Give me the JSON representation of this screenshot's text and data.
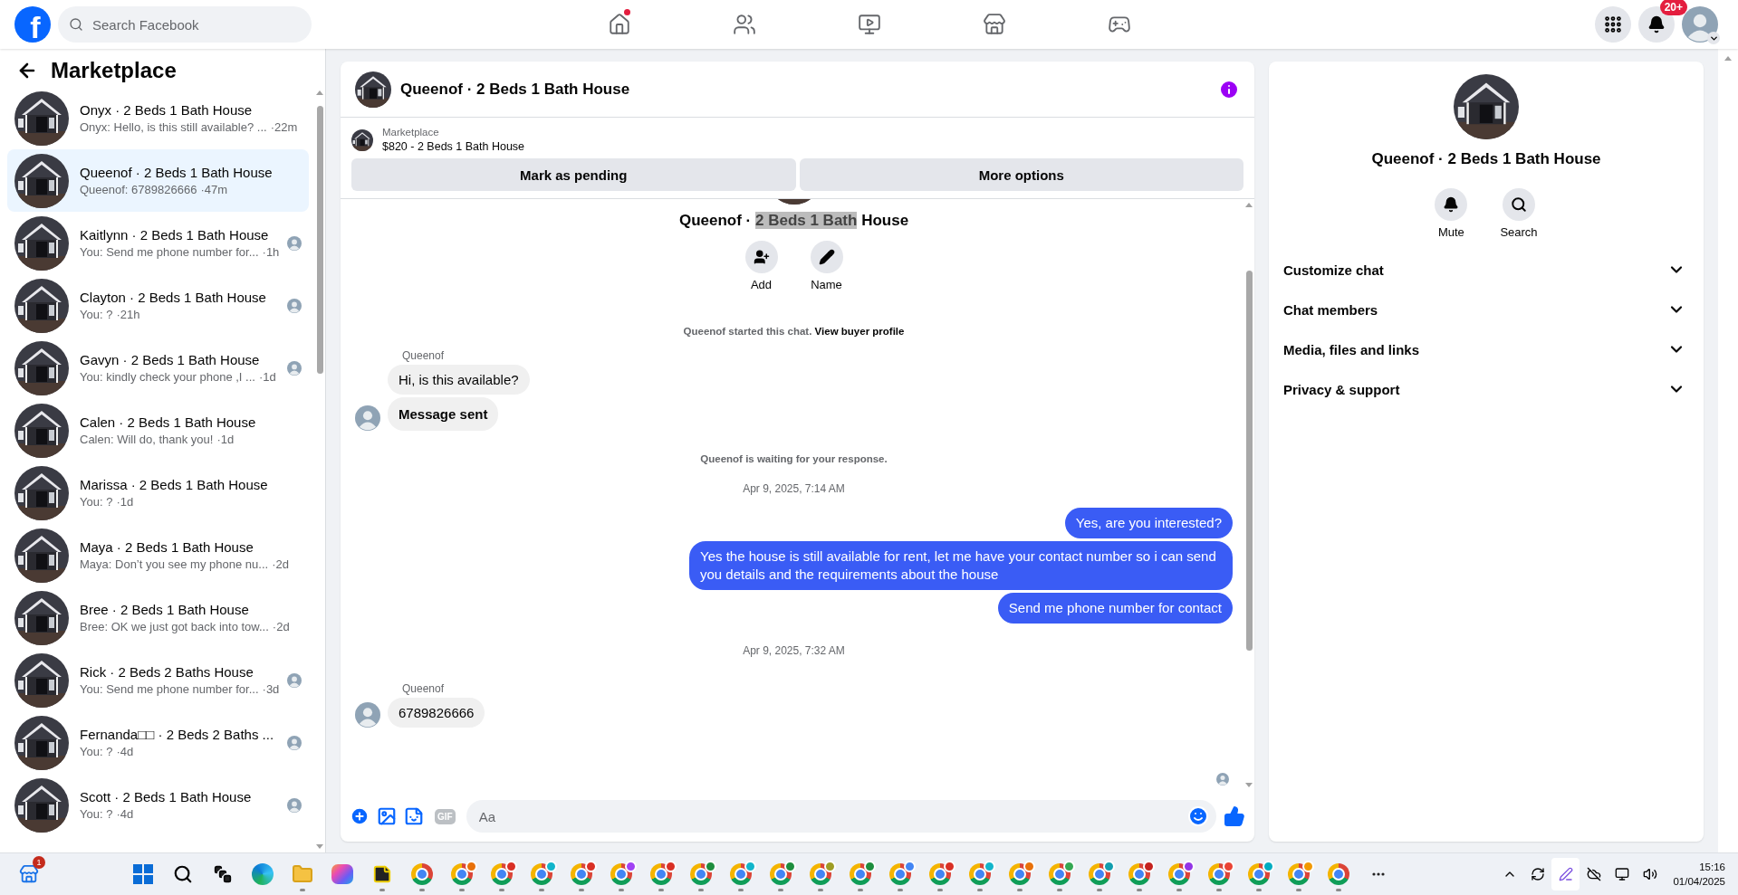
{
  "topbar": {
    "logo": "f",
    "search": {
      "placeholder": "Search Facebook"
    },
    "nav": [
      {
        "kind": "home",
        "dot": true
      },
      {
        "kind": "friends",
        "dot": false
      },
      {
        "kind": "video",
        "dot": false
      },
      {
        "kind": "marketplace",
        "dot": false
      },
      {
        "kind": "gaming",
        "dot": false
      }
    ],
    "notifications_badge": "20+"
  },
  "sidebar": {
    "title": "Marketplace",
    "conversations": [
      {
        "title": "Onyx · 2 Beds 1 Bath House",
        "preview": "Onyx: Hello, is this still available? ...",
        "time": "·22m",
        "seen": false,
        "selected": false
      },
      {
        "title": "Queenof · 2 Beds 1 Bath House",
        "preview": "Queenof: 6789826666",
        "time": "·47m",
        "seen": false,
        "selected": true
      },
      {
        "title": "Kaitlynn · 2 Beds 1 Bath House",
        "preview": "You: Send me phone number for...",
        "time": "·1h",
        "seen": true,
        "selected": false
      },
      {
        "title": "Clayton · 2 Beds 1 Bath House",
        "preview": "You: ?",
        "time": "·21h",
        "seen": true,
        "selected": false
      },
      {
        "title": "Gavyn · 2 Beds 1 Bath House",
        "preview": "You: kindly check your phone ,I ...",
        "time": "·1d",
        "seen": true,
        "selected": false
      },
      {
        "title": "Calen · 2 Beds 1 Bath House",
        "preview": "Calen: Will do, thank you!",
        "time": "·1d",
        "seen": false,
        "selected": false
      },
      {
        "title": "Marissa · 2 Beds 1 Bath House",
        "preview": "You: ?",
        "time": "·1d",
        "seen": false,
        "selected": false
      },
      {
        "title": "Maya · 2 Beds 1 Bath House",
        "preview": "Maya: Don’t you see my phone nu...",
        "time": "·2d",
        "seen": false,
        "selected": false
      },
      {
        "title": "Bree · 2 Beds 1 Bath House",
        "preview": "Bree: OK we just got back into tow...",
        "time": "·2d",
        "seen": false,
        "selected": false
      },
      {
        "title": "Rick · 2 Beds 2 Baths House",
        "preview": "You: Send me phone number for...",
        "time": "·3d",
        "seen": true,
        "selected": false
      },
      {
        "title": "Fernanda□□ · 2 Beds 2 Baths ...",
        "preview": "You: ?",
        "time": "·4d",
        "seen": true,
        "selected": false
      },
      {
        "title": "Scott · 2 Beds 1 Bath House",
        "preview": "You: ?",
        "time": "·4d",
        "seen": true,
        "selected": false
      }
    ]
  },
  "chat": {
    "header": {
      "title": "Queenof · 2 Beds 1 Bath House"
    },
    "listing": {
      "source": "Marketplace",
      "summary": "$820 - 2 Beds 1 Bath House",
      "buttons": [
        "Mark as pending",
        "More options"
      ]
    },
    "thread": {
      "title": {
        "before": "Queenof · ",
        "selected": "2 Beds 1 Bath",
        "after": " House"
      },
      "actions": [
        {
          "kind": "add",
          "label": "Add"
        },
        {
          "kind": "name",
          "label": "Name"
        }
      ],
      "items": [
        {
          "kind": "system",
          "text": "Queenof started this chat.",
          "link": "View buyer profile"
        },
        {
          "kind": "sender",
          "text": "Queenof"
        },
        {
          "kind": "incoming",
          "text": "Hi, is this available?",
          "avatar": false,
          "strong": false
        },
        {
          "kind": "incoming",
          "text": "Message sent",
          "avatar": true,
          "strong": true
        },
        {
          "kind": "system",
          "text": "Queenof is waiting for your response."
        },
        {
          "kind": "time",
          "text": "Apr 9, 2025, 7:14 AM"
        },
        {
          "kind": "outgoing",
          "text": "Yes, are you interested?"
        },
        {
          "kind": "outgoing",
          "text": "Yes the house is still available for rent, let me have your contact number so i can send you details and the requirements about the house"
        },
        {
          "kind": "outgoing",
          "text": "Send me phone number for contact"
        },
        {
          "kind": "time",
          "text": "Apr 9, 2025, 7:32 AM"
        },
        {
          "kind": "sender",
          "text": "Queenof"
        },
        {
          "kind": "incoming",
          "text": "6789826666",
          "avatar": true,
          "strong": false
        }
      ]
    },
    "composer": {
      "gif": "GIF",
      "placeholder": "Aa"
    }
  },
  "details": {
    "title": "Queenof · 2 Beds 1 Bath House",
    "actions": [
      {
        "kind": "mute",
        "label": "Mute"
      },
      {
        "kind": "search",
        "label": "Search"
      }
    ],
    "sections": [
      {
        "label": "Customize chat",
        "expanded": false
      },
      {
        "label": "Chat members",
        "expanded": false
      },
      {
        "label": "Media, files and links",
        "expanded": false
      },
      {
        "label": "Privacy & support",
        "expanded": false
      }
    ]
  },
  "taskbar": {
    "store_badge": "1",
    "apps": [
      {
        "kind": "start"
      },
      {
        "kind": "search"
      },
      {
        "kind": "taskview"
      },
      {
        "kind": "edge"
      },
      {
        "kind": "explorer"
      },
      {
        "kind": "copilot"
      },
      {
        "kind": "notes"
      },
      {
        "kind": "chrome"
      },
      {
        "kind": "profile",
        "color": "#e8710a"
      },
      {
        "kind": "profile",
        "color": "#d93025"
      },
      {
        "kind": "profile",
        "color": "#12b5cb"
      },
      {
        "kind": "profile",
        "color": "#d93025"
      },
      {
        "kind": "profile",
        "color": "#a142f4"
      },
      {
        "kind": "profile",
        "color": "#d93025"
      },
      {
        "kind": "profile",
        "color": "#1e8e3e"
      },
      {
        "kind": "profile",
        "color": "#12b5cb"
      },
      {
        "kind": "profile",
        "color": "#1e8e3e"
      },
      {
        "kind": "profile",
        "color": "#9e9d24"
      },
      {
        "kind": "profile",
        "color": "#1e8e3e"
      },
      {
        "kind": "profile",
        "color": "#4285f4"
      },
      {
        "kind": "profile",
        "color": "#d93025"
      },
      {
        "kind": "profile",
        "color": "#12b5cb"
      },
      {
        "kind": "profile",
        "color": "#e8710a"
      },
      {
        "kind": "profile",
        "color": "#34a853"
      },
      {
        "kind": "profile",
        "color": "#129eaf"
      },
      {
        "kind": "profile",
        "color": "#c5221f"
      },
      {
        "kind": "profile",
        "color": "#9334e6"
      },
      {
        "kind": "profile",
        "color": "#ea4335"
      },
      {
        "kind": "profile",
        "color": "#00acc1"
      },
      {
        "kind": "profile",
        "color": "#f29900"
      },
      {
        "kind": "chrome"
      },
      {
        "kind": "more"
      }
    ],
    "time": "15:16",
    "date": "01/04/2025"
  }
}
